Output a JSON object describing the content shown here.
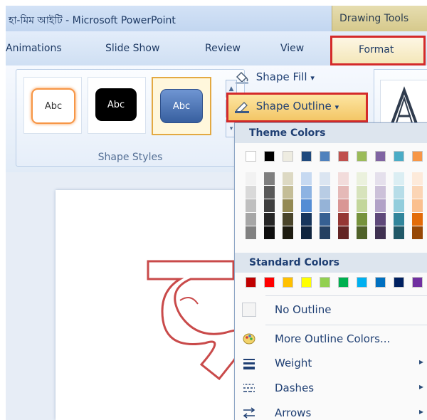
{
  "window": {
    "title": "হা-মিম আইটি - Microsoft PowerPoint",
    "context_tab": "Drawing Tools"
  },
  "tabs": [
    {
      "label": "Animations"
    },
    {
      "label": "Slide Show"
    },
    {
      "label": "Review"
    },
    {
      "label": "View"
    },
    {
      "label": "Format"
    }
  ],
  "ribbon": {
    "shape_styles": {
      "samples": [
        "Abc",
        "Abc",
        "Abc"
      ],
      "group_label": "Shape Styles"
    },
    "shape_fill_label": "Shape Fill",
    "shape_outline_label": "Shape Outline",
    "dropdown_caret": "▾"
  },
  "outline_menu": {
    "theme_colors_heading": "Theme Colors",
    "standard_colors_heading": "Standard Colors",
    "items": [
      {
        "label": "No Outline"
      },
      {
        "label": "More Outline Colors..."
      },
      {
        "label": "Weight"
      },
      {
        "label": "Dashes"
      },
      {
        "label": "Arrows"
      }
    ],
    "submenu_arrow": "▸"
  },
  "colors": {
    "highlight_red": "#d42a2a",
    "text_blue": "#1f3f73",
    "theme_top_row": [
      "#ffffff",
      "#000000",
      "#eeece1",
      "#1f497d",
      "#4f81bd",
      "#c0504d",
      "#9bbb59",
      "#8064a2",
      "#4bacc6",
      "#f79646"
    ],
    "theme_columns": [
      [
        "#f2f2f2",
        "#d9d9d9",
        "#bfbfbf",
        "#a6a6a6",
        "#808080"
      ],
      [
        "#7f7f7f",
        "#595959",
        "#3f3f3f",
        "#262626",
        "#0d0d0d"
      ],
      [
        "#ddd9c3",
        "#c4bd97",
        "#938953",
        "#4a452a",
        "#1d1b10"
      ],
      [
        "#c6d9f1",
        "#8db3e2",
        "#548dd4",
        "#17365d",
        "#0f243e"
      ],
      [
        "#dbe5f1",
        "#b8cce4",
        "#95b3d7",
        "#366092",
        "#244061"
      ],
      [
        "#f2dcdb",
        "#e5b9b7",
        "#d99694",
        "#953734",
        "#632423"
      ],
      [
        "#ebf1dd",
        "#d7e3bc",
        "#c3d69b",
        "#76923c",
        "#4f6128"
      ],
      [
        "#e5e0ec",
        "#ccc1d9",
        "#b2a2c7",
        "#5f497a",
        "#3f3151"
      ],
      [
        "#dbeef3",
        "#b7dde8",
        "#92cddc",
        "#31859b",
        "#205867"
      ],
      [
        "#fdeada",
        "#fbd5b5",
        "#fac08f",
        "#e36c09",
        "#974806"
      ]
    ],
    "standard": [
      "#c00000",
      "#ff0000",
      "#ffc000",
      "#ffff00",
      "#92d050",
      "#00b050",
      "#00b0f0",
      "#0070c0",
      "#002060",
      "#7030a0"
    ]
  }
}
